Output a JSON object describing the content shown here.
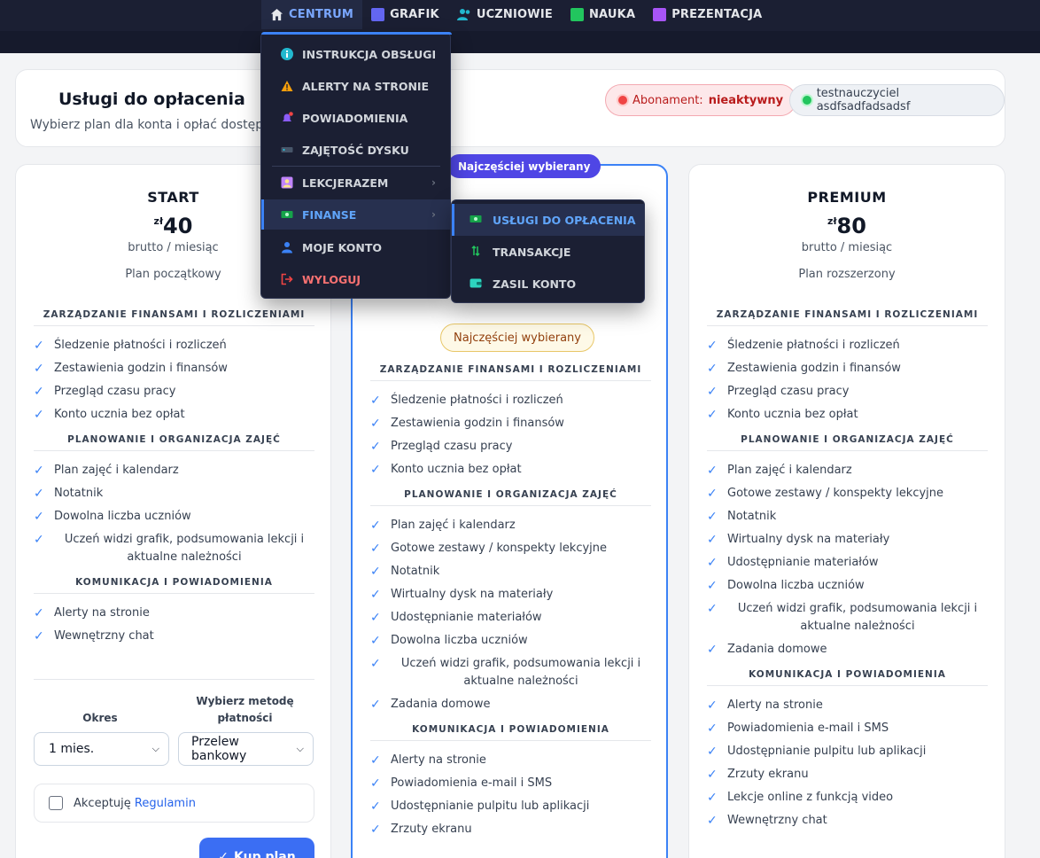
{
  "nav": {
    "items": [
      {
        "label": "CENTRUM",
        "icon": "home-icon",
        "color": "#7aa7ff"
      },
      {
        "label": "GRAFIK",
        "icon": "calendar-icon",
        "color": "#6366f1"
      },
      {
        "label": "UCZNIOWIE",
        "icon": "users-icon",
        "color": "#22b8cf"
      },
      {
        "label": "NAUKA",
        "icon": "book-icon",
        "color": "#22c55e"
      },
      {
        "label": "PREZENTACJA",
        "icon": "presentation-icon",
        "color": "#a855f7"
      }
    ]
  },
  "menu": {
    "items": [
      {
        "label": "INSTRUKCJA OBSŁUGI",
        "icon": "info-icon"
      },
      {
        "label": "ALERTY NA STRONIE",
        "icon": "warning-icon"
      },
      {
        "label": "POWIADOMIENIA",
        "icon": "bell-icon"
      },
      {
        "label": "ZAJĘTOŚĆ DYSKU",
        "icon": "disk-icon"
      },
      {
        "label": "LEKCJERAZEM",
        "icon": "person-card-icon"
      },
      {
        "label": "FINANSE",
        "icon": "money-icon"
      },
      {
        "label": "MOJE KONTO",
        "icon": "user-icon"
      },
      {
        "label": "WYLOGUJ",
        "icon": "logout-icon"
      }
    ]
  },
  "submenu": {
    "items": [
      {
        "label": "USŁUGI DO OPŁACENIA",
        "icon": "money-icon"
      },
      {
        "label": "TRANSAKCJE",
        "icon": "transfer-icon"
      },
      {
        "label": "ZASIL KONTO",
        "icon": "wallet-icon"
      }
    ]
  },
  "header": {
    "title": "Usługi do opłacenia",
    "subtitle": "Wybierz plan dla konta i opłać dostęp.",
    "subscription_label": "Abonament:",
    "subscription_status": "nieaktywny",
    "user": "testnauczyciel asdfsadfadsadsf"
  },
  "plans": {
    "start": {
      "name": "START",
      "currency": "zł",
      "price": "40",
      "per": "brutto / miesiąc",
      "desc": "Plan początkowy",
      "sections": [
        {
          "title": "ZARZĄDZANIE FINANSAMI I ROZLICZENIAMI",
          "items": [
            "Śledzenie płatności i rozliczeń",
            "Zestawienia godzin i finansów",
            "Przegląd czasu pracy",
            "Konto ucznia bez opłat"
          ]
        },
        {
          "title": "PLANOWANIE I ORGANIZACJA ZAJĘĆ",
          "items": [
            "Plan zajęć i kalendarz",
            "Notatnik",
            "Dowolna liczba uczniów",
            "Uczeń widzi grafik, podsumowania lekcji i aktualne należności"
          ]
        },
        {
          "title": "KOMUNIKACJA I POWIADOMIENIA",
          "items": [
            "Alerty na stronie",
            "Wewnętrzny chat"
          ]
        }
      ],
      "period_label": "Okres",
      "method_label": "Wybierz metodę płatności",
      "period_value": "1 mies.",
      "method_value": "Przelew bankowy",
      "accept_text": "Akceptuję",
      "accept_link": "Regulamin",
      "buy_label": "Kup plan"
    },
    "mid": {
      "top_pill": "Najczęściej wybierany",
      "pill": "Najczęściej wybierany",
      "sections": [
        {
          "title": "ZARZĄDZANIE FINANSAMI I ROZLICZENIAMI",
          "items": [
            "Śledzenie płatności i rozliczeń",
            "Zestawienia godzin i finansów",
            "Przegląd czasu pracy",
            "Konto ucznia bez opłat"
          ]
        },
        {
          "title": "PLANOWANIE I ORGANIZACJA ZAJĘĆ",
          "items": [
            "Plan zajęć i kalendarz",
            "Gotowe zestawy / konspekty lekcyjne",
            "Notatnik",
            "Wirtualny dysk na materiały",
            "Udostępnianie materiałów",
            "Dowolna liczba uczniów",
            "Uczeń widzi grafik, podsumowania lekcji i aktualne należności",
            "Zadania domowe"
          ]
        },
        {
          "title": "KOMUNIKACJA I POWIADOMIENIA",
          "items": [
            "Alerty na stronie",
            "Powiadomienia e-mail i SMS",
            "Udostępnianie pulpitu lub aplikacji",
            "Zrzuty ekranu"
          ]
        }
      ]
    },
    "premium": {
      "name": "PREMIUM",
      "currency": "zł",
      "price": "80",
      "per": "brutto / miesiąc",
      "desc": "Plan rozszerzony",
      "sections": [
        {
          "title": "ZARZĄDZANIE FINANSAMI I ROZLICZENIAMI",
          "items": [
            "Śledzenie płatności i rozliczeń",
            "Zestawienia godzin i finansów",
            "Przegląd czasu pracy",
            "Konto ucznia bez opłat"
          ]
        },
        {
          "title": "PLANOWANIE I ORGANIZACJA ZAJĘĆ",
          "items": [
            "Plan zajęć i kalendarz",
            "Gotowe zestawy / konspekty lekcyjne",
            "Notatnik",
            "Wirtualny dysk na materiały",
            "Udostępnianie materiałów",
            "Dowolna liczba uczniów",
            "Uczeń widzi grafik, podsumowania lekcji i aktualne należności",
            "Zadania domowe"
          ]
        },
        {
          "title": "KOMUNIKACJA I POWIADOMIENIA",
          "items": [
            "Alerty na stronie",
            "Powiadomienia e-mail i SMS",
            "Udostępnianie pulpitu lub aplikacji",
            "Zrzuty ekranu",
            "Lekcje online z funkcją video",
            "Wewnętrzny chat"
          ]
        }
      ]
    }
  }
}
